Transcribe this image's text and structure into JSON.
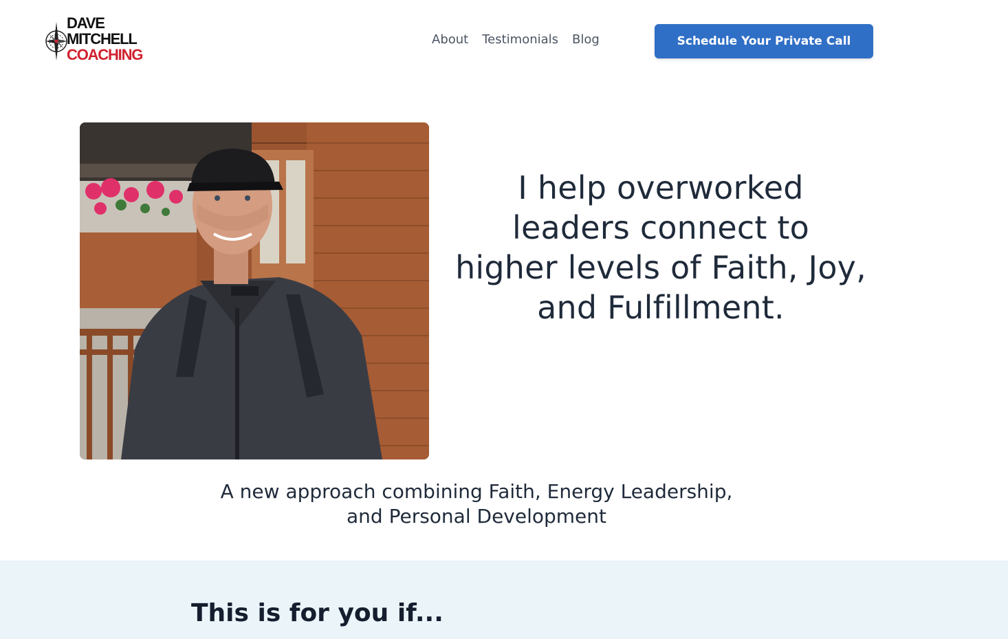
{
  "brand": {
    "logo_line1": "DAVE",
    "logo_line2": "MITCHELL",
    "logo_line3": "COACHING",
    "logo_icon": "compass-icon",
    "accent_red": "#d0202e"
  },
  "nav": {
    "items": [
      {
        "label": "About"
      },
      {
        "label": "Testimonials"
      },
      {
        "label": "Blog"
      }
    ],
    "cta_label": "Schedule Your Private Call",
    "cta_color": "#2f6fc6"
  },
  "hero": {
    "photo_alt": "portrait-photo",
    "headline_lines": [
      "I help overworked",
      "leaders connect to",
      "higher levels of Faith, Joy,",
      "and Fulfillment."
    ],
    "subhead_lines": [
      "A new approach combining Faith, Energy Leadership,",
      "and Personal Development"
    ]
  },
  "section": {
    "title": "This is for you if...",
    "background": "#eaf4f9"
  }
}
